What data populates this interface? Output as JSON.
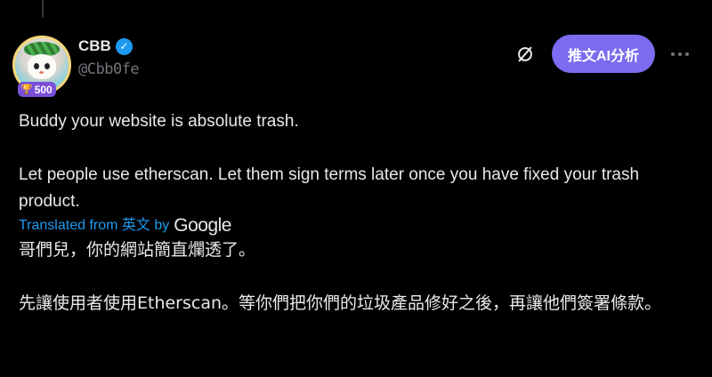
{
  "author": {
    "display_name": "CBB",
    "handle": "@Cbb0fe",
    "rank_badge": "500",
    "verified_icon": "verified-check-icon"
  },
  "actions": {
    "grok_icon": "slash-circle-icon",
    "ai_button_label": "推文AI分析",
    "more_icon": "more-dots-icon",
    "more_label": "···"
  },
  "tweet": {
    "line1": "Buddy your website is absolute trash.",
    "line2": "Let people use etherscan. Let them sign terms later once you have fixed your trash product."
  },
  "translation": {
    "prefix": "Translated from 英文 by",
    "provider": "Google",
    "line1": "哥們兒，你的網站簡直爛透了。",
    "line2": "先讓使用者使用Etherscan。等你們把你們的垃圾產品修好之後，再讓他們簽署條款。"
  },
  "colors": {
    "background": "#000000",
    "link": "#1d9bf0",
    "ai_button": "#7b6cf0",
    "rank_badge": "#7a4fd9"
  }
}
